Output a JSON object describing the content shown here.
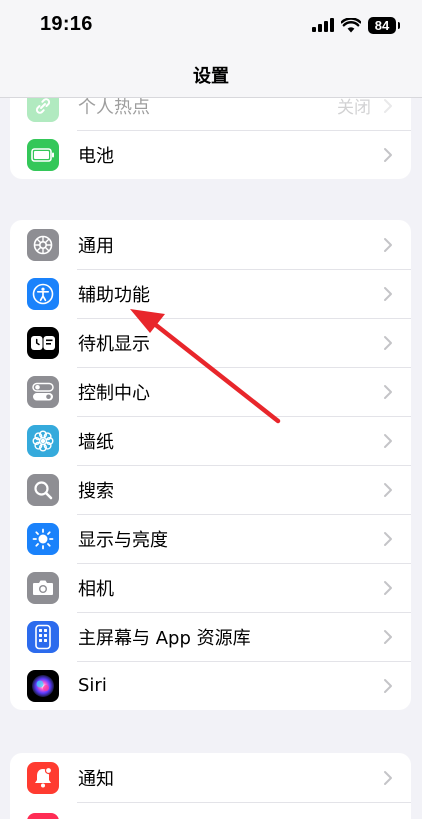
{
  "status": {
    "time": "19:16",
    "battery": "84"
  },
  "nav": {
    "title": "设置"
  },
  "groups": [
    {
      "items": [
        {
          "label": "个人热点",
          "value": "关闭",
          "icon": "hotspot-icon",
          "color": "#34c759"
        },
        {
          "label": "电池",
          "icon": "battery-icon",
          "color": "#34c759"
        }
      ]
    },
    {
      "items": [
        {
          "label": "通用",
          "icon": "gear-icon",
          "color": "#8e8e93"
        },
        {
          "label": "辅助功能",
          "icon": "accessibility-icon",
          "color": "#1a82fb"
        },
        {
          "label": "待机显示",
          "icon": "standby-icon",
          "color": "#000000"
        },
        {
          "label": "控制中心",
          "icon": "toggles-icon",
          "color": "#8e8e93"
        },
        {
          "label": "墙纸",
          "icon": "flower-icon",
          "color": "#35aadc"
        },
        {
          "label": "搜索",
          "icon": "search-icon",
          "color": "#8e8e93"
        },
        {
          "label": "显示与亮度",
          "icon": "brightness-icon",
          "color": "#1a82fb"
        },
        {
          "label": "相机",
          "icon": "camera-icon",
          "color": "#8e8e93"
        },
        {
          "label": "主屏幕与 App 资源库",
          "icon": "home-screen-icon",
          "color": "#2c6bed"
        },
        {
          "label": "Siri",
          "icon": "siri-icon",
          "color": "#000000"
        }
      ]
    },
    {
      "items": [
        {
          "label": "通知",
          "icon": "bell-icon",
          "color": "#ff3b30"
        }
      ]
    }
  ]
}
